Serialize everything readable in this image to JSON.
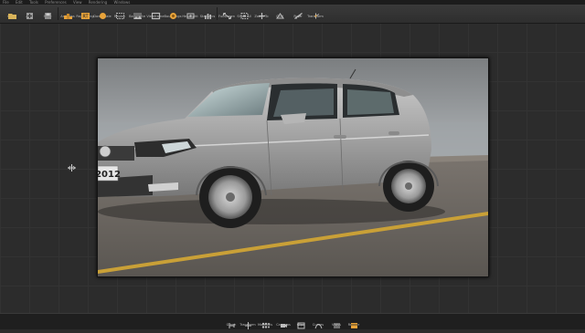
{
  "menu": [
    "File",
    "Edit",
    "Tools",
    "Preferences",
    "View",
    "Rendering",
    "Windows"
  ],
  "toolbar": [
    {
      "label": "Open",
      "icon": "folder-icon"
    },
    {
      "label": "Add",
      "icon": "add-icon"
    },
    {
      "label": "Save",
      "icon": "save-icon"
    },
    {
      "label": "Antialias",
      "icon": "antialias-icon"
    },
    {
      "label": "Raytracing",
      "icon": "raytracing-icon"
    },
    {
      "label": "Downscale",
      "icon": "downscale-icon"
    },
    {
      "label": "Region",
      "icon": "region-icon"
    },
    {
      "label": "Backplate",
      "icon": "backplate-icon"
    },
    {
      "label": "Viewframe",
      "icon": "viewframe-icon"
    },
    {
      "label": "Boundings",
      "icon": "boundings-icon"
    },
    {
      "label": "Headlight",
      "icon": "headlight-icon"
    },
    {
      "label": "Statistics",
      "icon": "statistics-icon"
    },
    {
      "label": "Fullscreen",
      "icon": "fullscreen-icon"
    },
    {
      "label": "Show All",
      "icon": "show-all-icon"
    },
    {
      "label": "Zoom To",
      "icon": "zoom-to-icon"
    },
    {
      "label": "Grid",
      "icon": "grid-icon"
    },
    {
      "label": "Ruler",
      "icon": "ruler-icon"
    },
    {
      "label": "Transform",
      "icon": "transform-icon"
    }
  ],
  "viewer": {
    "license_plate": "2012",
    "colors": {
      "car_body": "#a9a9a9",
      "road": "#6c6864",
      "road_line": "#c9a037",
      "sky": "#9ea3a6"
    }
  },
  "dock": [
    {
      "label": "Graph",
      "icon": "graph-icon"
    },
    {
      "label": "Transform",
      "icon": "transform-icon"
    },
    {
      "label": "Materials",
      "icon": "materials-icon"
    },
    {
      "label": "Cameras",
      "icon": "cameras-icon"
    },
    {
      "label": "Clips",
      "icon": "clips-icon"
    },
    {
      "label": "Curves",
      "icon": "curves-icon"
    },
    {
      "label": "VSets",
      "icon": "vsets-icon"
    },
    {
      "label": "Render",
      "icon": "render-icon"
    }
  ],
  "colors": {
    "accent": "#e8a33a",
    "toolbar_bg": "#353535",
    "workspace_bg": "#2c2c2c"
  }
}
